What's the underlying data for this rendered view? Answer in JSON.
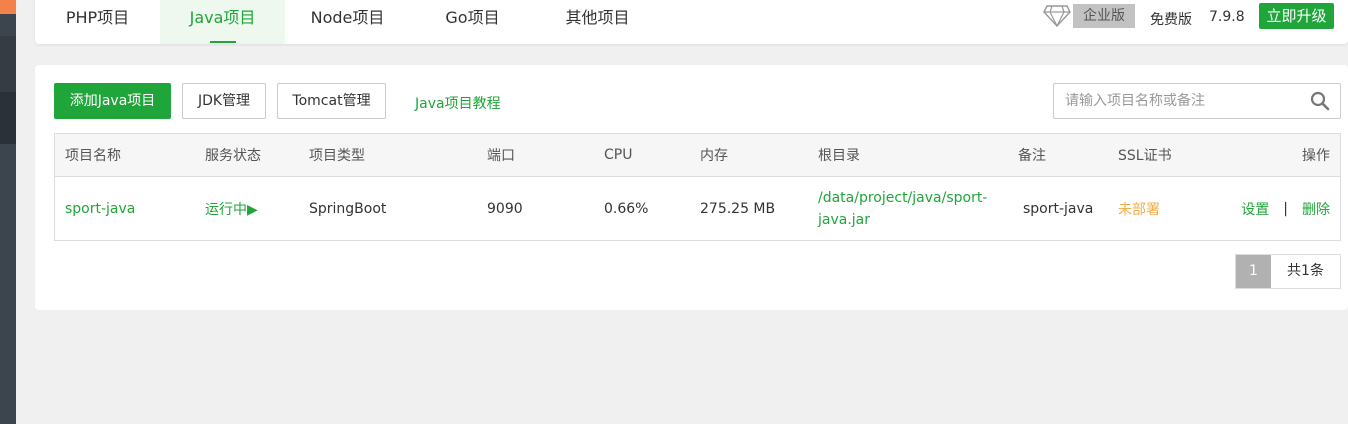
{
  "tabs": [
    {
      "label": "PHP项目"
    },
    {
      "label": "Java项目",
      "active": true
    },
    {
      "label": "Node项目"
    },
    {
      "label": "Go项目"
    },
    {
      "label": "其他项目"
    }
  ],
  "header": {
    "edition": "企业版",
    "free_label": "免费版",
    "version": "7.9.8",
    "upgrade_label": "立即升级"
  },
  "toolbar": {
    "add_label": "添加Java项目",
    "jdk_label": "JDK管理",
    "tomcat_label": "Tomcat管理",
    "tutorial_label": "Java项目教程",
    "search_placeholder": "请输入项目名称或备注"
  },
  "table": {
    "headers": {
      "name": "项目名称",
      "status": "服务状态",
      "type": "项目类型",
      "port": "端口",
      "cpu": "CPU",
      "memory": "内存",
      "root": "根目录",
      "note": "备注",
      "ssl": "SSL证书",
      "ops": "操作"
    },
    "rows": [
      {
        "name": "sport-java",
        "status": "运行中▶",
        "type": "SpringBoot",
        "port": "9090",
        "cpu": "0.66%",
        "memory": "275.25 MB",
        "root_line1": "/data/project/java/sport-",
        "root_line2": "java.jar",
        "note": "sport-java",
        "ssl": "未部署",
        "op_settings": "设置",
        "op_sep": "|",
        "op_delete": "删除"
      }
    ]
  },
  "pagination": {
    "current": "1",
    "total": "共1条"
  },
  "colors": {
    "accent": "#20a53a",
    "warning": "#f0ad4e",
    "sidebar": "#3c444d"
  }
}
